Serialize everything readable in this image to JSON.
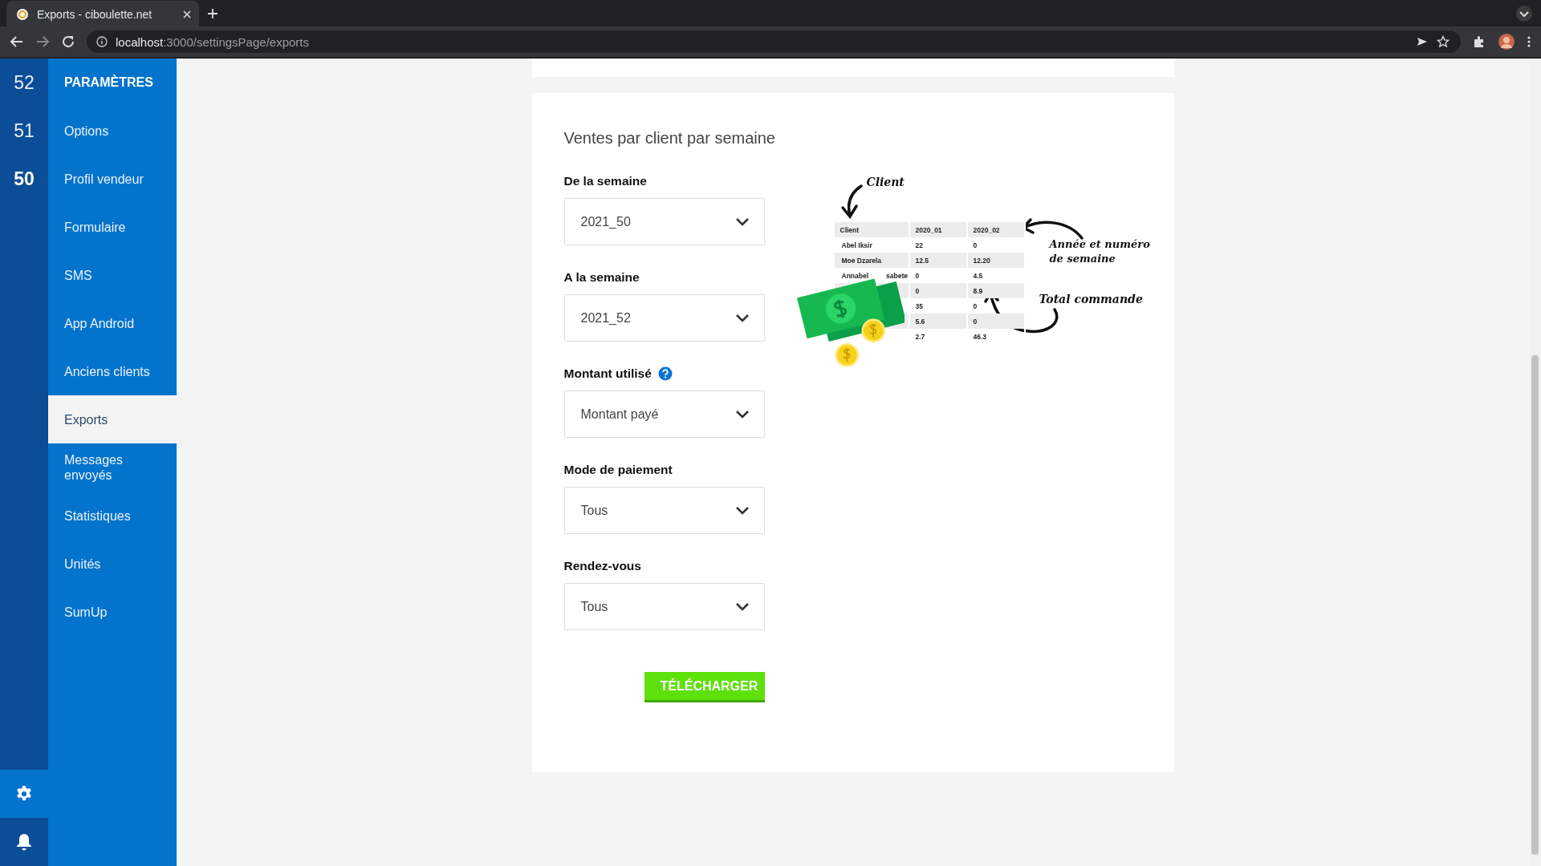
{
  "browser": {
    "tab_title": "Exports - ciboulette.net",
    "url_host": "localhost",
    "url_path": ":3000/settingsPage/exports"
  },
  "week_rail": [
    {
      "label": "52",
      "selected": false
    },
    {
      "label": "51",
      "selected": false
    },
    {
      "label": "50",
      "selected": true
    }
  ],
  "rail_buttons": [
    {
      "kind": "settings",
      "selected": true
    },
    {
      "kind": "notifications",
      "selected": false
    }
  ],
  "sidebar": {
    "title": "PARAMÈTRES",
    "items": [
      {
        "label": "Options",
        "selected": false
      },
      {
        "label": "Profil vendeur",
        "selected": false
      },
      {
        "label": "Formulaire",
        "selected": false
      },
      {
        "label": "SMS",
        "selected": false
      },
      {
        "label": "App Android",
        "selected": false
      },
      {
        "label": "Anciens clients",
        "selected": false
      },
      {
        "label": "Exports",
        "selected": true
      },
      {
        "label": "Messages envoyés",
        "selected": false
      },
      {
        "label": "Statistiques",
        "selected": false
      },
      {
        "label": "Unités",
        "selected": false
      },
      {
        "label": "SumUp",
        "selected": false
      }
    ]
  },
  "export_card": {
    "title": "Ventes par client par semaine",
    "fields": [
      {
        "label": "De la semaine",
        "value": "2021_50",
        "help": false
      },
      {
        "label": "A la semaine",
        "value": "2021_52",
        "help": false
      },
      {
        "label": "Montant utilisé",
        "value": "Montant payé",
        "help": true
      },
      {
        "label": "Mode de paiement",
        "value": "Tous",
        "help": false
      },
      {
        "label": "Rendez-vous",
        "value": "Tous",
        "help": false
      }
    ],
    "button": "TÉLÉCHARGER",
    "illustration": {
      "annotations": [
        "Client",
        "Année et numéro de semaine",
        "Total commande"
      ],
      "columns": [
        "Client",
        "2020_01",
        "2020_02"
      ],
      "rows": [
        {
          "name_parts": [
            "Abel Iksir"
          ],
          "values": [
            "22",
            "0"
          ]
        },
        {
          "name_parts": [
            "Moe Dzarela"
          ],
          "values": [
            "12.5",
            "12.20"
          ]
        },
        {
          "name_parts": [
            "Annabel",
            "sabete"
          ],
          "values": [
            "0",
            "4.5"
          ]
        },
        {
          "values": [
            "0",
            "8.9"
          ]
        },
        {
          "values": [
            "35",
            "0"
          ]
        },
        {
          "values": [
            "5.6",
            "0"
          ]
        },
        {
          "values": [
            "2.7",
            "46.3"
          ]
        }
      ]
    }
  }
}
